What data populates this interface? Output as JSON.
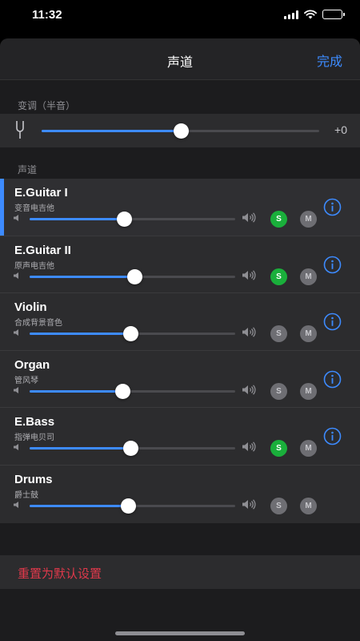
{
  "status_bar": {
    "time": "11:32"
  },
  "nav": {
    "title": "声道",
    "done_label": "完成"
  },
  "pitch": {
    "section_label": "变调（半音）",
    "value_text": "+0",
    "fraction": 0.5
  },
  "channels_section_label": "声道",
  "tracks": [
    {
      "name": "E.Guitar I",
      "subtitle": "变音电吉他",
      "volume": 0.46,
      "solo": true,
      "info": true,
      "selected": true,
      "s_label": "S",
      "m_label": "M"
    },
    {
      "name": "E.Guitar II",
      "subtitle": "原声电吉他",
      "volume": 0.51,
      "solo": true,
      "info": true,
      "selected": false,
      "s_label": "S",
      "m_label": "M"
    },
    {
      "name": "Violin",
      "subtitle": "合成背景音色",
      "volume": 0.49,
      "solo": false,
      "info": true,
      "selected": false,
      "s_label": "S",
      "m_label": "M"
    },
    {
      "name": "Organ",
      "subtitle": "管风琴",
      "volume": 0.45,
      "solo": false,
      "info": true,
      "selected": false,
      "s_label": "S",
      "m_label": "M"
    },
    {
      "name": "E.Bass",
      "subtitle": "指弹电贝司",
      "volume": 0.49,
      "solo": true,
      "info": true,
      "selected": false,
      "s_label": "S",
      "m_label": "M"
    },
    {
      "name": "Drums",
      "subtitle": "爵士鼓",
      "volume": 0.48,
      "solo": false,
      "info": false,
      "selected": false,
      "s_label": "S",
      "m_label": "M"
    }
  ],
  "reset_label": "重置为默认设置",
  "colors": {
    "accent": "#3d8bff",
    "solo_on": "#1aaf3b",
    "destructive": "#e0394b"
  }
}
